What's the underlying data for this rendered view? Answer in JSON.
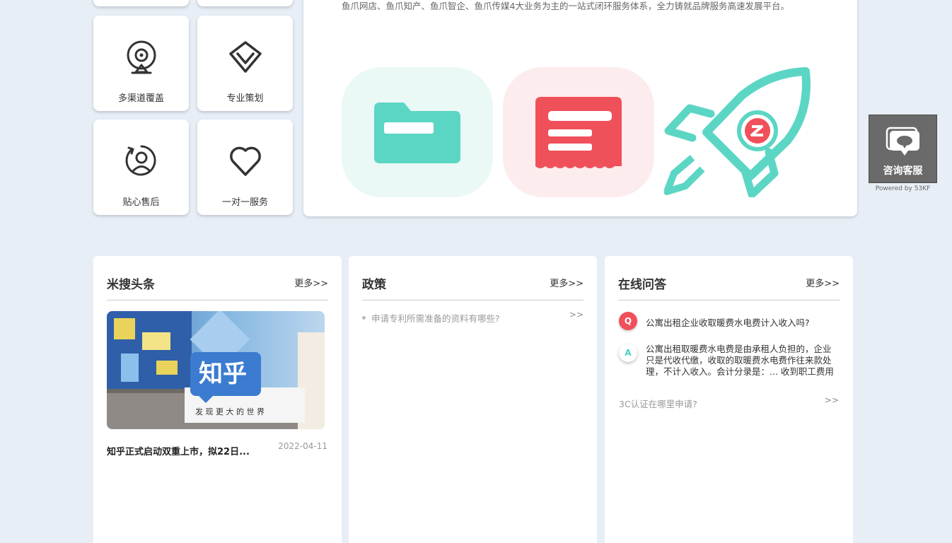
{
  "features": [
    {
      "label": "多渠道覆盖",
      "icon": "camera-icon"
    },
    {
      "label": "专业策划",
      "icon": "diamond-icon"
    },
    {
      "label": "贴心售后",
      "icon": "user-refresh-icon"
    },
    {
      "label": "一对一服务",
      "icon": "heart-icon"
    }
  ],
  "intro": {
    "text": "鱼爪网店、鱼爪知产、鱼爪智企、鱼爪传媒4大业务为主的一站式闭环服务体系，全力铸就品牌服务高速发展平台。",
    "icons": [
      "folder-icon",
      "document-icon",
      "rocket-icon"
    ]
  },
  "consult": {
    "label": "咨询客服",
    "powered": "Powered by 53KF",
    "icon": "chat-bubble-icon"
  },
  "columns": {
    "news": {
      "title": "米搜头条",
      "more": "更多>>",
      "image_text_main": "知乎",
      "image_text_sub": "发 现 更 大 的 世 界",
      "item_title": "知乎正式启动双重上市，拟22日...",
      "item_date": "2022-04-11"
    },
    "policy": {
      "title": "政策",
      "more": "更多>>",
      "items": [
        {
          "text": "申请专利所需准备的资料有哪些?",
          "arrow": ">>"
        }
      ]
    },
    "qa": {
      "title": "在线问答",
      "more": "更多>>",
      "q_badge": "Q",
      "a_badge": "A",
      "question": "公寓出租企业收取暖费水电费计入收入吗?",
      "answer": "公寓出租取暖费水电费是由承租人负担的，企业只是代收代缴，收取的取暖费水电费作往来款处理，不计入收入。会计分录是：... 收到职工费用",
      "link": "3C认证在哪里申请?",
      "link_arrow": ">>"
    }
  },
  "colors": {
    "background": "#e8eef6",
    "teal": "#5cd6c4",
    "red": "#f0505a",
    "pink_bg": "#fdecee",
    "mint_bg": "#eaf8f6"
  }
}
